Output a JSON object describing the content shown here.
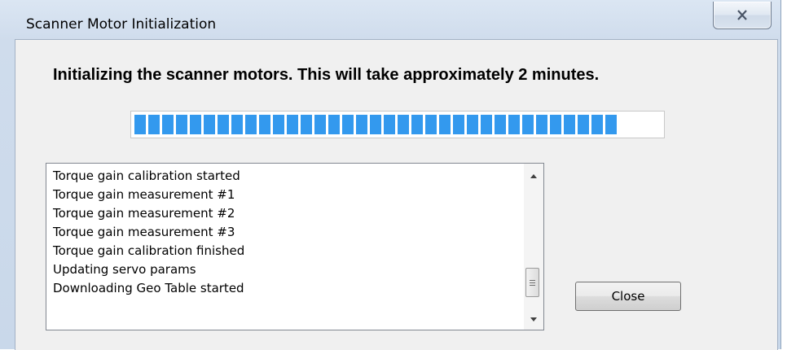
{
  "window": {
    "title": "Scanner Motor Initialization",
    "close_glyph": "X",
    "close_icon": "close-x-icon"
  },
  "dialog": {
    "message": "Initializing the scanner motors.  This will take approximately 2 minutes.",
    "progress_percent": 92,
    "progress_color": "#3399ee",
    "log_lines": [
      "Torque gain calibration started",
      "Torque gain measurement #1",
      "Torque gain measurement #2",
      "Torque gain measurement #3",
      "Torque gain calibration finished",
      "Updating servo params",
      "Downloading Geo Table started"
    ],
    "scroll_up_icon": "triangle-up-icon",
    "scroll_down_icon": "triangle-down-icon",
    "close_button_label": "Close"
  }
}
